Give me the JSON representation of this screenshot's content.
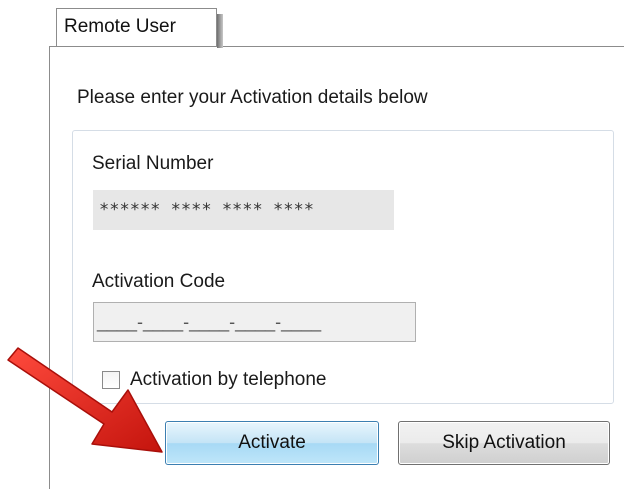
{
  "tab": {
    "label": "Remote User"
  },
  "form": {
    "instructions": "Please enter your Activation details below",
    "serial_number": {
      "label": "Serial Number",
      "value": "****** **** **** ****"
    },
    "activation_code": {
      "label": "Activation Code",
      "value": "____-____-____-____-____"
    },
    "telephone_checkbox": {
      "label": "Activation by telephone",
      "checked": false
    }
  },
  "buttons": {
    "activate_label": "Activate",
    "skip_label": "Skip Activation"
  },
  "colors": {
    "arrow": "#e8231c",
    "activate_border": "#3c7fb1",
    "group_border": "#d5dde6"
  },
  "annotation": {
    "icon": "red-arrow-icon"
  }
}
